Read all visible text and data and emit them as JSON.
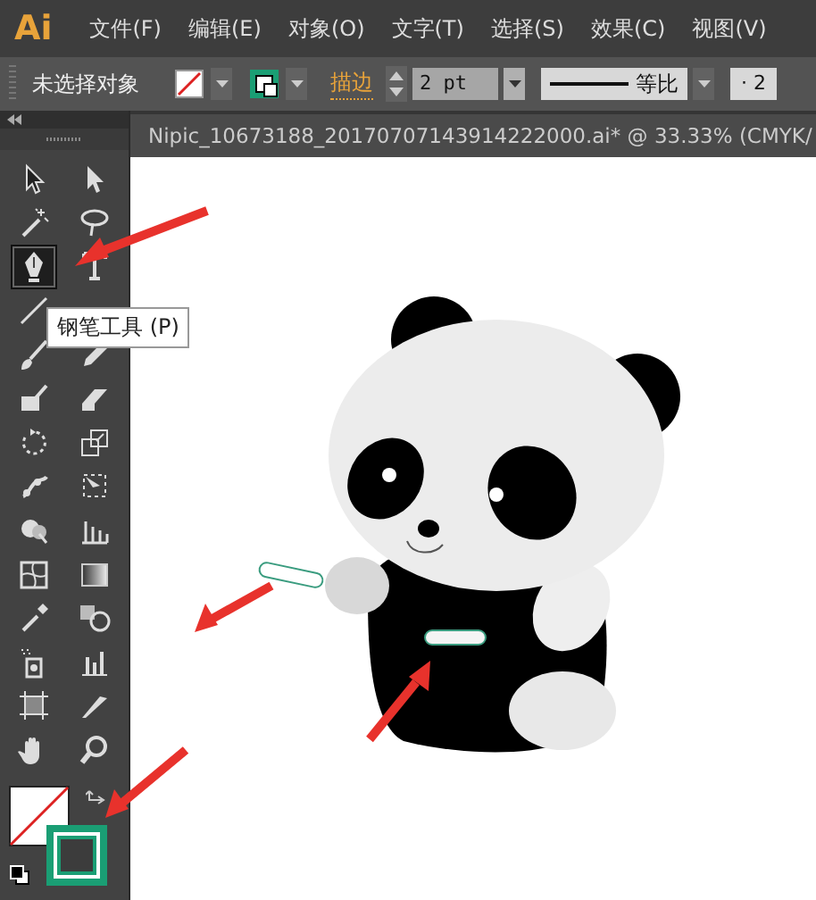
{
  "app": {
    "logo": "Ai"
  },
  "menu": [
    "文件(F)",
    "编辑(E)",
    "对象(O)",
    "文字(T)",
    "选择(S)",
    "效果(C)",
    "视图(V)"
  ],
  "control_bar": {
    "selection": "未选择对象",
    "stroke_label": "描边",
    "stroke_weight": "2 pt",
    "profile": "等比",
    "field_cut": "· 2"
  },
  "document_tab": {
    "title": "Nipic_10673188_20170707143914222000.ai*  @  33.33%  (CMYK/"
  },
  "tools": [
    {
      "kind": "select",
      "selected": false
    },
    {
      "kind": "direct",
      "selected": false
    },
    {
      "kind": "wand",
      "selected": false
    },
    {
      "kind": "lasso",
      "selected": false
    },
    {
      "kind": "pen",
      "selected": true
    },
    {
      "kind": "type",
      "selected": false
    },
    {
      "kind": "line",
      "selected": false
    },
    {
      "kind": "brush",
      "selected": false
    },
    {
      "kind": "pencil",
      "selected": false
    },
    {
      "kind": "blob",
      "selected": false
    },
    {
      "kind": "eraser",
      "selected": false
    },
    {
      "kind": "rotate",
      "selected": false
    },
    {
      "kind": "scale",
      "selected": false
    },
    {
      "kind": "puppet",
      "selected": false
    },
    {
      "kind": "transform",
      "selected": false
    },
    {
      "kind": "builder",
      "selected": false
    },
    {
      "kind": "graph",
      "selected": false
    },
    {
      "kind": "mesh",
      "selected": false
    },
    {
      "kind": "gradient",
      "selected": false
    },
    {
      "kind": "eyedropper",
      "selected": false
    },
    {
      "kind": "blend",
      "selected": false
    },
    {
      "kind": "sprayer",
      "selected": false
    },
    {
      "kind": "column",
      "selected": false
    },
    {
      "kind": "artboard",
      "selected": false
    },
    {
      "kind": "knife",
      "selected": false
    },
    {
      "kind": "hand",
      "selected": false
    },
    {
      "kind": "zoom",
      "selected": false
    }
  ],
  "tooltip": {
    "text": "钢笔工具 (P)"
  }
}
